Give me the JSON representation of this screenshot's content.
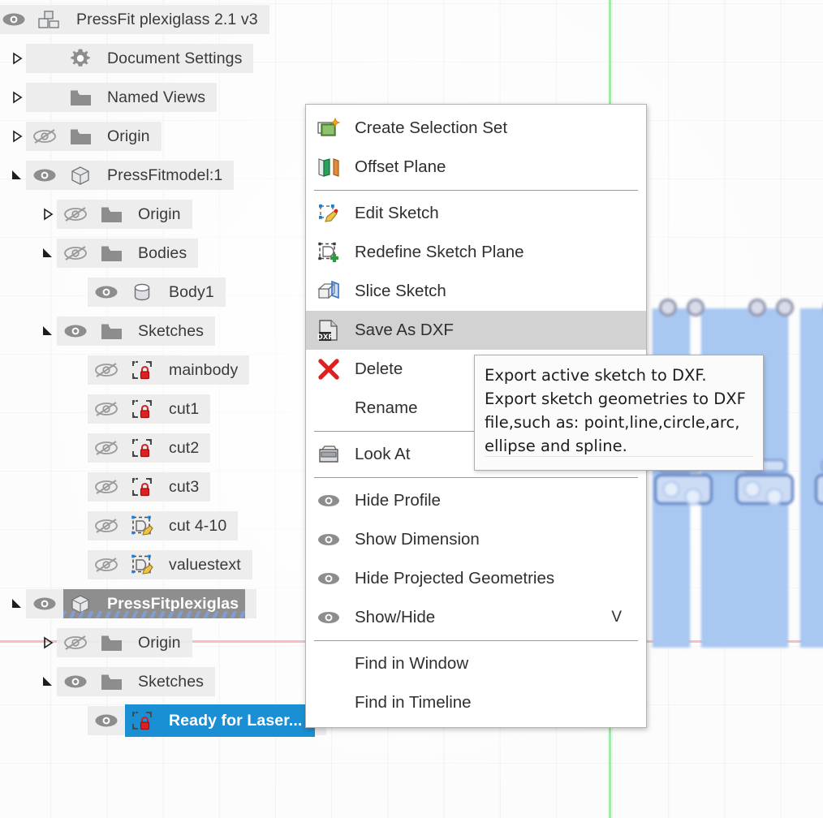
{
  "app": {
    "title": "PressFit plexiglass 2.1 v3"
  },
  "viewport": {
    "green_axis_color": "#8ce99a",
    "red_axis_color": "#f7b3b3",
    "sketch_fill_color": "#a8c8f2"
  },
  "browser_tree": {
    "root": {
      "label": "PressFit plexiglass 2.1 v3",
      "icon": "assembly-icon",
      "visibility": "eye-open-icon",
      "expander": "expanded-triangle-icon"
    },
    "items": [
      {
        "label": "Document Settings",
        "icon": "gear-icon",
        "visibility": null,
        "expander": "collapsed-triangle-icon",
        "indent": 0,
        "state": "normal"
      },
      {
        "label": "Named Views",
        "icon": "folder-icon",
        "visibility": null,
        "expander": "collapsed-triangle-icon",
        "indent": 0,
        "state": "normal"
      },
      {
        "label": "Origin",
        "icon": "folder-icon",
        "visibility": "eye-off-icon",
        "expander": "collapsed-triangle-icon",
        "indent": 0,
        "state": "normal"
      },
      {
        "label": "PressFitmodel:1",
        "icon": "component-icon",
        "visibility": "eye-open-icon",
        "expander": "expanded-triangle-icon",
        "indent": 0,
        "state": "normal"
      },
      {
        "label": "Origin",
        "icon": "folder-icon",
        "visibility": "eye-off-icon",
        "expander": "collapsed-triangle-icon",
        "indent": 1,
        "state": "normal"
      },
      {
        "label": "Bodies",
        "icon": "folder-icon",
        "visibility": "eye-off-icon",
        "expander": "expanded-triangle-icon",
        "indent": 1,
        "state": "normal"
      },
      {
        "label": "Body1",
        "icon": "body-icon",
        "visibility": "eye-open-icon",
        "expander": null,
        "indent": 2,
        "state": "normal"
      },
      {
        "label": "Sketches",
        "icon": "folder-icon",
        "visibility": "eye-open-icon",
        "expander": "expanded-triangle-icon",
        "indent": 1,
        "state": "normal"
      },
      {
        "label": "mainbody",
        "icon": "sketch-locked-icon",
        "visibility": "eye-off-icon",
        "expander": null,
        "indent": 2,
        "state": "normal"
      },
      {
        "label": "cut1",
        "icon": "sketch-locked-icon",
        "visibility": "eye-off-icon",
        "expander": null,
        "indent": 2,
        "state": "normal"
      },
      {
        "label": "cut2",
        "icon": "sketch-locked-icon",
        "visibility": "eye-off-icon",
        "expander": null,
        "indent": 2,
        "state": "normal"
      },
      {
        "label": "cut3",
        "icon": "sketch-locked-icon",
        "visibility": "eye-off-icon",
        "expander": null,
        "indent": 2,
        "state": "normal"
      },
      {
        "label": "cut 4-10",
        "icon": "sketch-edit-icon",
        "visibility": "eye-off-icon",
        "expander": null,
        "indent": 2,
        "state": "normal"
      },
      {
        "label": "valuestext",
        "icon": "sketch-edit-icon",
        "visibility": "eye-off-icon",
        "expander": null,
        "indent": 2,
        "state": "normal"
      },
      {
        "label": "PressFitplexiglas",
        "icon": "component-icon",
        "visibility": "eye-open-icon",
        "expander": "expanded-triangle-icon",
        "indent": 0,
        "state": "selected-gray"
      },
      {
        "label": "Origin",
        "icon": "folder-icon",
        "visibility": "eye-off-icon",
        "expander": "collapsed-triangle-icon",
        "indent": 1,
        "state": "normal"
      },
      {
        "label": "Sketches",
        "icon": "folder-icon",
        "visibility": "eye-open-icon",
        "expander": "expanded-triangle-icon",
        "indent": 1,
        "state": "normal"
      },
      {
        "label": "Ready for Laser...",
        "icon": "sketch-locked-icon",
        "visibility": "eye-open-icon",
        "expander": null,
        "indent": 2,
        "state": "selected-blue"
      }
    ]
  },
  "context_menu": {
    "highlighted_item": "Save As DXF",
    "items": [
      {
        "label": "Create Selection Set",
        "icon": "selection-set-icon",
        "accel": "",
        "separator_after": false
      },
      {
        "label": "Offset Plane",
        "icon": "offset-plane-icon",
        "accel": "",
        "separator_after": true
      },
      {
        "label": "Edit Sketch",
        "icon": "edit-sketch-icon",
        "accel": "",
        "separator_after": false
      },
      {
        "label": "Redefine Sketch Plane",
        "icon": "redefine-plane-icon",
        "accel": "",
        "separator_after": false
      },
      {
        "label": "Slice Sketch",
        "icon": "slice-sketch-icon",
        "accel": "",
        "separator_after": false
      },
      {
        "label": "Save As DXF",
        "icon": "dxf-file-icon",
        "accel": "",
        "separator_after": false
      },
      {
        "label": "Delete",
        "icon": "delete-x-icon",
        "accel": "",
        "separator_after": false
      },
      {
        "label": "Rename",
        "icon": "",
        "accel": "",
        "separator_after": true
      },
      {
        "label": "Look At",
        "icon": "look-at-icon",
        "accel": "",
        "separator_after": true
      },
      {
        "label": "Hide Profile",
        "icon": "eye-icon",
        "accel": "",
        "separator_after": false
      },
      {
        "label": "Show Dimension",
        "icon": "eye-icon",
        "accel": "",
        "separator_after": false
      },
      {
        "label": "Hide Projected Geometries",
        "icon": "eye-icon",
        "accel": "",
        "separator_after": false
      },
      {
        "label": "Show/Hide",
        "icon": "eye-icon",
        "accel": "V",
        "separator_after": true
      },
      {
        "label": "Find in Window",
        "icon": "",
        "accel": "",
        "separator_after": false
      },
      {
        "label": "Find in Timeline",
        "icon": "",
        "accel": "",
        "separator_after": false
      }
    ]
  },
  "tooltip": {
    "lines": [
      "Export active sketch to DXF.",
      "Export sketch geometries to DXF",
      "file,such as: point,line,circle,arc,",
      "ellipse and spline."
    ]
  }
}
